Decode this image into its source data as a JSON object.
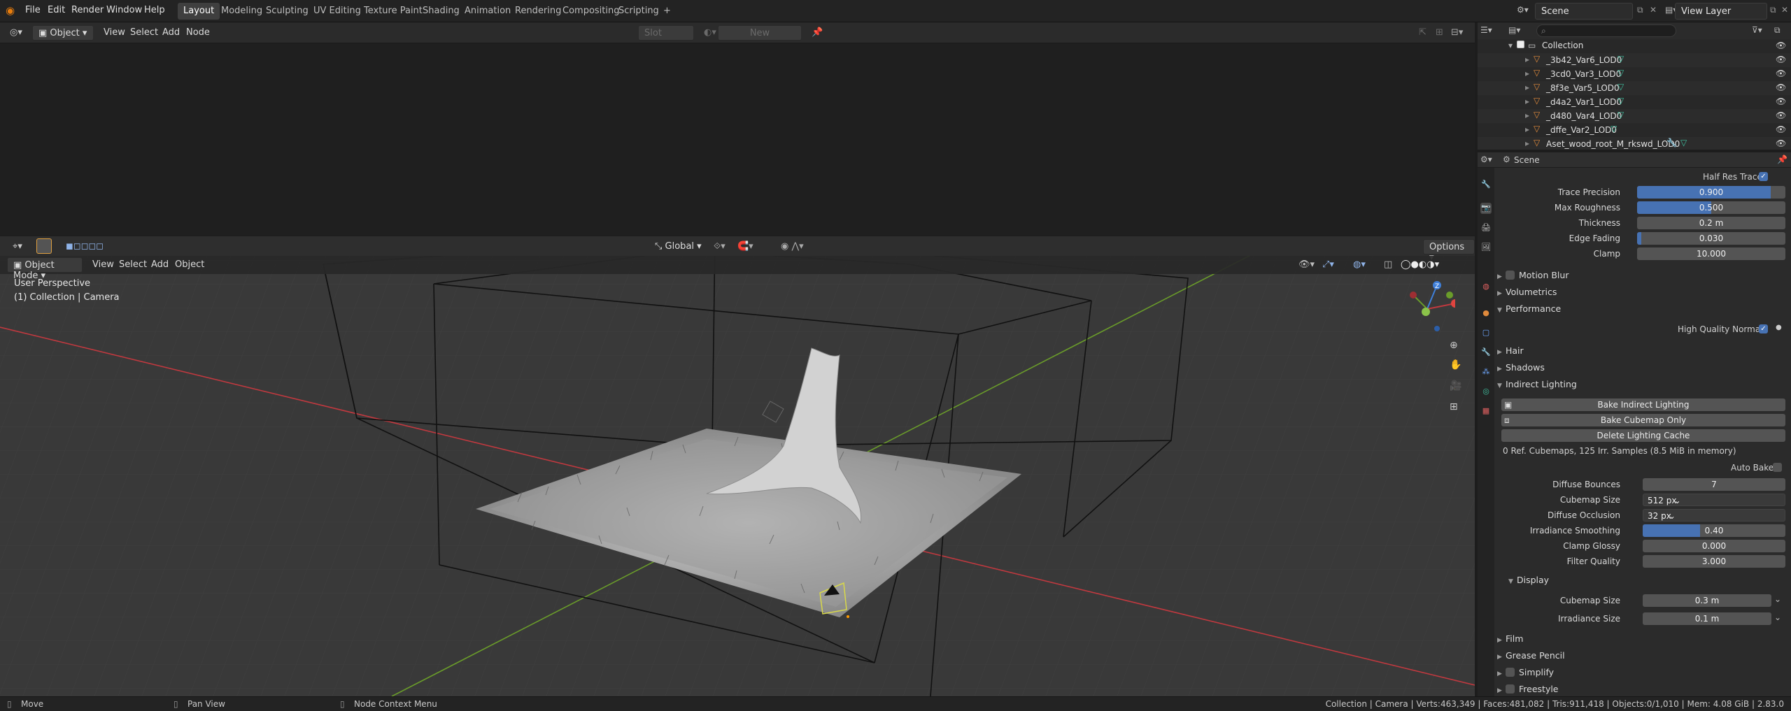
{
  "topbar": {
    "menus": [
      "File",
      "Edit",
      "Render",
      "Window",
      "Help"
    ],
    "workspaces": [
      "Layout",
      "Modeling",
      "Sculpting",
      "UV Editing",
      "Texture Paint",
      "Shading",
      "Animation",
      "Rendering",
      "Compositing",
      "Scripting"
    ],
    "active_workspace": "Layout",
    "add_tab": "+",
    "scene_name": "Scene",
    "view_layer": "View Layer"
  },
  "shader_editor": {
    "object_type": "Object",
    "menus": [
      "View",
      "Select",
      "Add",
      "Node"
    ],
    "slot": "Slot",
    "new_button": "New"
  },
  "viewport": {
    "transform_orientation": "Global",
    "options": "Options",
    "mode": "Object Mode",
    "menus": [
      "View",
      "Select",
      "Add",
      "Object"
    ],
    "perspective": "User Perspective",
    "collection_info": "(1) Collection | Camera",
    "gizmo": {
      "z": "Z",
      "y": "Y",
      "x": "X"
    }
  },
  "outliner": {
    "collection": "Collection",
    "items": [
      "_3b42_Var6_LOD0",
      "_3cd0_Var3_LOD0",
      "_8f3e_Var5_LOD0",
      "_d4a2_Var1_LOD0",
      "_d480_Var4_LOD0",
      "_dffe_Var2_LOD0",
      "Aset_wood_root_M_rkswd_LOD0"
    ]
  },
  "properties": {
    "header": "Scene",
    "half_res_trace": "Half Res Trace",
    "ssr_fields": [
      {
        "label": "Trace Precision",
        "value": "0.900",
        "fill": 0.9
      },
      {
        "label": "Max Roughness",
        "value": "0.500",
        "fill": 0.5
      },
      {
        "label": "Thickness",
        "value": "0.2 m",
        "fill": 0
      },
      {
        "label": "Edge Fading",
        "value": "0.030",
        "fill": 0.03
      },
      {
        "label": "Clamp",
        "value": "10.000",
        "fill": 0
      }
    ],
    "sections": {
      "motion_blur": "Motion Blur",
      "volumetrics": "Volumetrics",
      "performance": "Performance",
      "high_quality_normals": "High Quality Normals",
      "hair": "Hair",
      "shadows": "Shadows",
      "indirect_lighting": "Indirect Lighting",
      "display": "Display",
      "film": "Film",
      "grease_pencil": "Grease Pencil",
      "simplify": "Simplify",
      "freestyle": "Freestyle"
    },
    "buttons": {
      "bake_indirect": "Bake Indirect Lighting",
      "bake_cubemap": "Bake Cubemap Only",
      "delete_cache": "Delete Lighting Cache"
    },
    "cache_info": "0 Ref. Cubemaps, 125 Irr. Samples (8.5 MiB in memory)",
    "auto_bake": "Auto Bake",
    "indirect_fields": [
      {
        "label": "Diffuse Bounces",
        "value": "7",
        "fill": 0
      },
      {
        "label": "Cubemap Size",
        "value": "512 px",
        "fill": 0,
        "dropdown": true
      },
      {
        "label": "Diffuse Occlusion",
        "value": "32 px",
        "fill": 0,
        "dropdown": true
      },
      {
        "label": "Irradiance Smoothing",
        "value": "0.40",
        "fill": 0.4
      },
      {
        "label": "Clamp Glossy",
        "value": "0.000",
        "fill": 0
      },
      {
        "label": "Filter Quality",
        "value": "3.000",
        "fill": 0
      }
    ],
    "display_fields": [
      {
        "label": "Cubemap Size",
        "value": "0.3 m"
      },
      {
        "label": "Irradiance Size",
        "value": "0.1 m"
      }
    ]
  },
  "statusbar": {
    "move": "Move",
    "pan": "Pan View",
    "context": "Node Context Menu",
    "stats": "Collection | Camera | Verts:463,349 | Faces:481,082 | Tris:911,418 | Objects:0/1,010 | Mem: 4.08 GiB | 2.83.0"
  },
  "colors": {
    "accent": "#4772b3",
    "x_axis": "#c0393f",
    "y_axis": "#6a9c2a",
    "z_axis": "#3f7fd9",
    "mesh_icon": "#e08a3c",
    "data_icon": "#3fbf9f"
  }
}
